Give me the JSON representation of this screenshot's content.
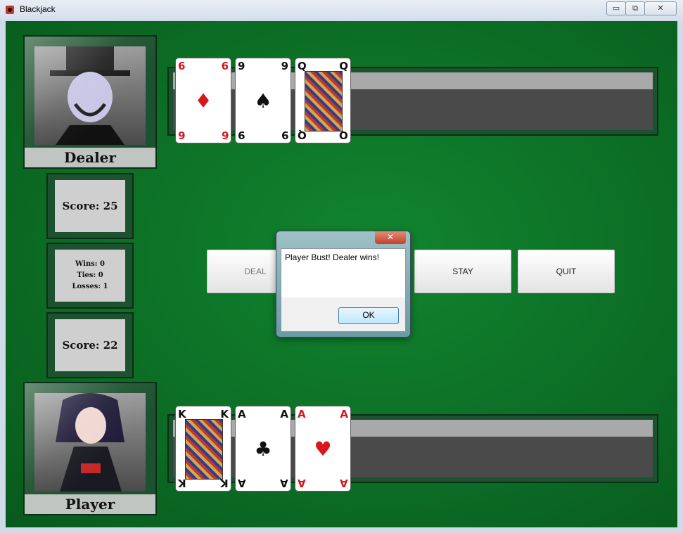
{
  "window": {
    "title": "Blackjack",
    "minimize": "▭",
    "maximize": "⧉",
    "close": "✕"
  },
  "dealer": {
    "name": "Dealer",
    "score_text": "Score: 25",
    "cards": [
      {
        "rank": "6",
        "suit": "♦",
        "color": "red",
        "pip": "♦"
      },
      {
        "rank": "9",
        "suit": "♠",
        "color": "black",
        "pip": "♠"
      },
      {
        "rank": "Q",
        "suit": "♠",
        "color": "black",
        "pip": ""
      }
    ]
  },
  "player": {
    "name": "Player",
    "score_text": "Score: 22",
    "cards": [
      {
        "rank": "K",
        "suit": "♠",
        "color": "black",
        "pip": ""
      },
      {
        "rank": "A",
        "suit": "♣",
        "color": "black",
        "pip": "♣"
      },
      {
        "rank": "A",
        "suit": "♥",
        "color": "red",
        "pip": "♥"
      }
    ]
  },
  "stats": {
    "wins": "Wins: 0",
    "ties": "Ties: 0",
    "losses": "Losses: 1"
  },
  "buttons": {
    "deal": "DEAL",
    "stay": "STAY",
    "quit": "QUIT"
  },
  "dialog": {
    "close": "✕",
    "message": "Player Bust! Dealer wins!",
    "ok": "OK"
  },
  "colors": {
    "felt": "#0c6e25",
    "red_suit": "#d8161b",
    "black_suit": "#111111"
  }
}
